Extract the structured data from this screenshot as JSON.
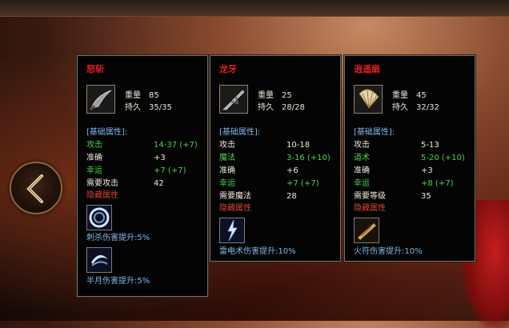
{
  "cards": [
    {
      "name": "怒斩",
      "weight_label": "重量",
      "weight_value": "85",
      "durability_label": "持久",
      "durability_value": "35/35",
      "section": "[基础属性]:",
      "attrs": [
        {
          "label": "攻击",
          "value": "14-37 (+7)",
          "color": "green"
        },
        {
          "label": "准确",
          "value": "+3",
          "color": "white"
        },
        {
          "label": "幸运",
          "value": "+7 (+7)",
          "color": "green"
        },
        {
          "label": "需要攻击",
          "value": "42",
          "color": "white"
        }
      ],
      "hidden_label": "隐藏属性",
      "skills": [
        {
          "text": "刺杀伤害提升:5%",
          "icon": "thrust-slash-skill-icon"
        },
        {
          "text": "半月伤害提升:5%",
          "icon": "half-moon-skill-icon"
        }
      ]
    },
    {
      "name": "龙牙",
      "weight_label": "重量",
      "weight_value": "25",
      "durability_label": "持久",
      "durability_value": "28/28",
      "section": "[基础属性]:",
      "attrs": [
        {
          "label": "攻击",
          "value": "10-18",
          "color": "white"
        },
        {
          "label": "魔法",
          "value": "3-16 (+10)",
          "color": "green"
        },
        {
          "label": "准确",
          "value": "+6",
          "color": "white"
        },
        {
          "label": "幸运",
          "value": "+7 (+7)",
          "color": "green"
        },
        {
          "label": "需要魔法",
          "value": "28",
          "color": "white"
        }
      ],
      "hidden_label": "隐藏属性",
      "skills": [
        {
          "text": "雷电术伤害提升:10%",
          "icon": "lightning-skill-icon"
        }
      ]
    },
    {
      "name": "逍遥扇",
      "weight_label": "重量",
      "weight_value": "45",
      "durability_label": "持久",
      "durability_value": "32/32",
      "section": "[基础属性]:",
      "attrs": [
        {
          "label": "攻击",
          "value": "5-13",
          "color": "white"
        },
        {
          "label": "道术",
          "value": "5-20 (+10)",
          "color": "green"
        },
        {
          "label": "准确",
          "value": "+3",
          "color": "white"
        },
        {
          "label": "幸运",
          "value": "+8 (+7)",
          "color": "green"
        },
        {
          "label": "需要等级",
          "value": "35",
          "color": "white"
        }
      ],
      "hidden_label": "隐藏属性",
      "skills": [
        {
          "text": "火符伤害提升:10%",
          "icon": "fire-talisman-skill-icon"
        }
      ]
    }
  ],
  "colors": {
    "name": "#e02020",
    "green": "#4cd24c",
    "white": "#ece8dc",
    "section": "#7fb8e8",
    "hidden": "#d9452a"
  }
}
